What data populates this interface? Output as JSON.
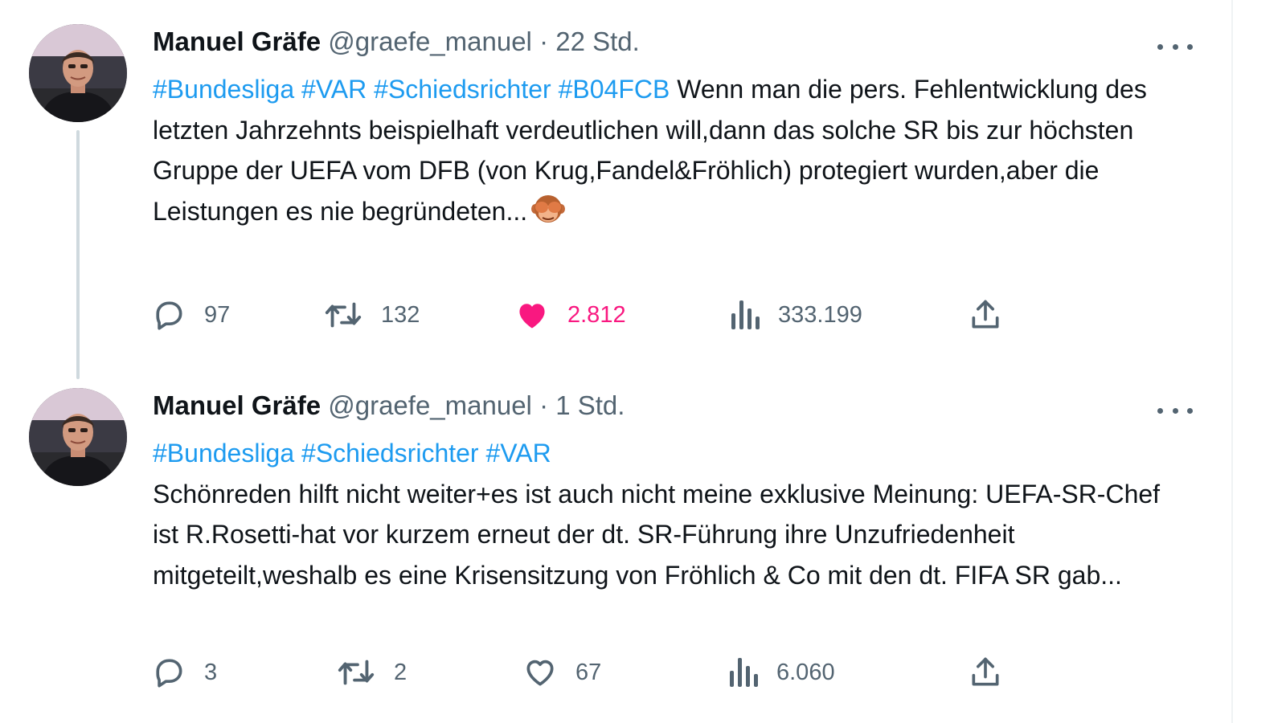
{
  "tweets": [
    {
      "author_name": "Manuel Gräfe",
      "handle": "@graefe_manuel",
      "separator": "·",
      "time": "22 Std.",
      "hashtags": [
        "#Bundesliga",
        "#VAR",
        "#Schiedsrichter",
        "#B04FCB"
      ],
      "text": "Wenn man die pers. Fehlentwicklung des letzten Jahrzehnts beispielhaft verdeutlichen will,dann das solche SR bis zur höchsten Gruppe der UEFA vom DFB (von Krug,Fandel&Fröhlich) protegiert wurden,aber die Leistungen es nie begründeten...",
      "emoji": "see-no-evil-monkey",
      "replies": "97",
      "retweets": "132",
      "likes": "2.812",
      "liked": true,
      "views": "333.199"
    },
    {
      "author_name": "Manuel Gräfe",
      "handle": "@graefe_manuel",
      "separator": "·",
      "time": "1 Std.",
      "hashtags": [
        "#Bundesliga",
        "#Schiedsrichter",
        "#VAR"
      ],
      "text": "Schönreden hilft nicht weiter+es ist auch nicht meine exklusive Meinung: UEFA-SR-Chef ist R.Rosetti-hat vor kurzem erneut der dt. SR-Führung ihre Unzufriedenheit mitgeteilt,weshalb es eine Krisensitzung von Fröhlich & Co mit den dt. FIFA SR gab...",
      "replies": "3",
      "retweets": "2",
      "likes": "67",
      "liked": false,
      "views": "6.060"
    }
  ],
  "icons": {
    "reply": "reply-icon",
    "retweet": "retweet-icon",
    "like": "heart-icon",
    "views": "views-icon",
    "share": "share-icon",
    "more": "more-icon"
  },
  "colors": {
    "hashtag": "#1d9bf0",
    "muted": "#536471",
    "like_active": "#f91880",
    "thread_line": "#cfd9de"
  }
}
